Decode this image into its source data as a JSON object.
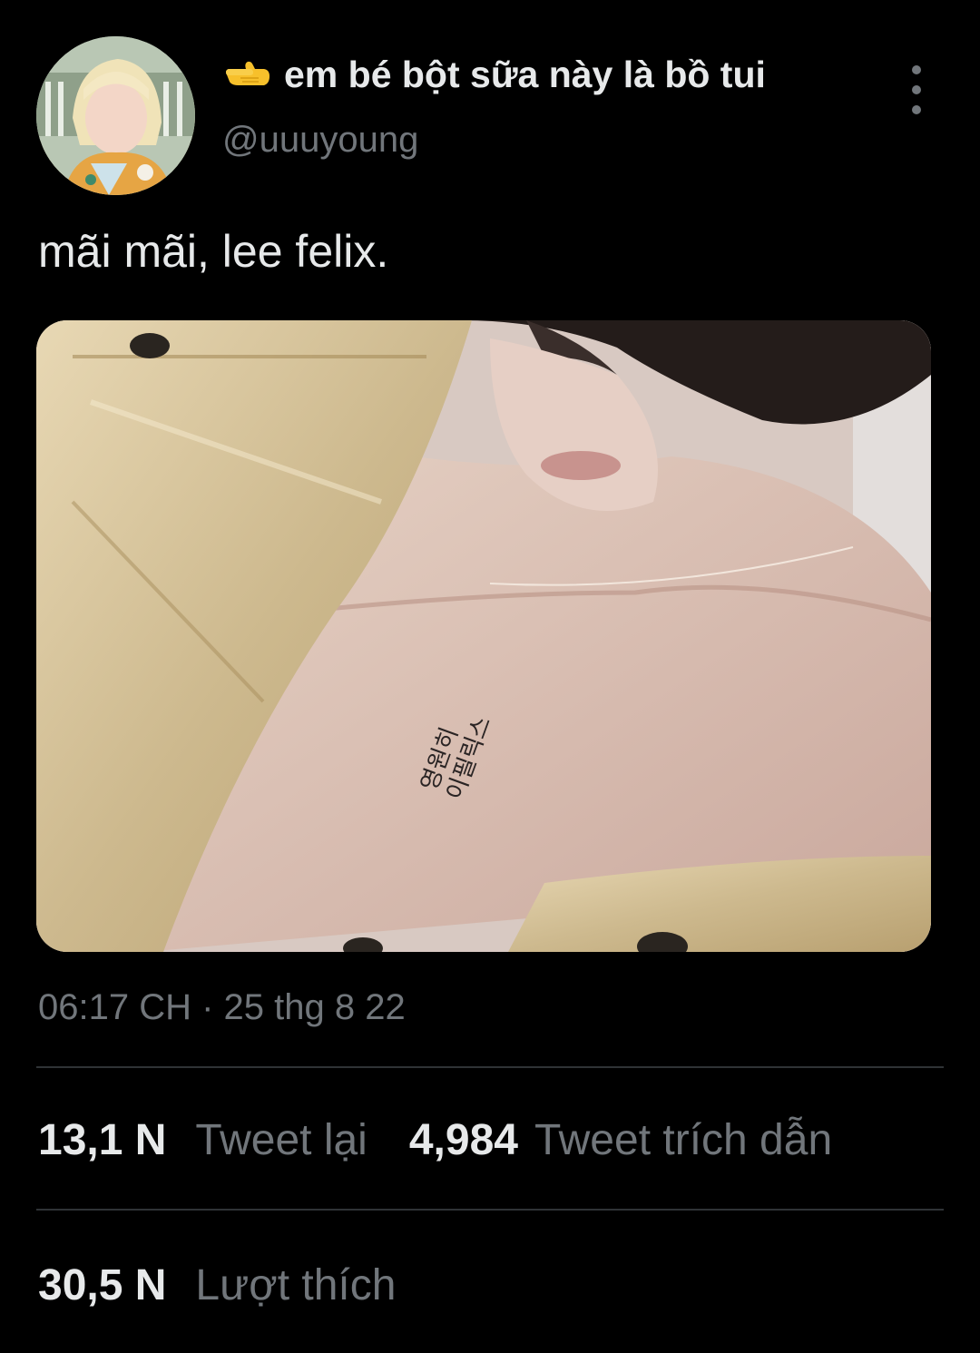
{
  "author": {
    "emoji": "👈",
    "display_name": "em bé bột sữa này là bồ tui",
    "handle": "@uuuyoung"
  },
  "tweet": {
    "text": "mãi mãi, lee felix.",
    "media_tattoo_text": [
      "영원히",
      "이필릭스"
    ],
    "timestamp": "06:17 CH · 25 thg 8 22"
  },
  "stats": {
    "retweets_count": "13,1 N",
    "retweets_label": "Tweet lại",
    "quotes_count": "4,984",
    "quotes_label": "Tweet trích dẫn",
    "likes_count": "30,5 N",
    "likes_label": "Lượt thích"
  },
  "icons": {
    "pointing": "backhand-index-pointing-left-icon",
    "more": "more-options-icon"
  },
  "colors": {
    "background": "#000000",
    "primary_text": "#e7e9ea",
    "secondary_text": "#71767b",
    "divider": "#2f3336",
    "emoji_yellow": "#f7c02b"
  }
}
